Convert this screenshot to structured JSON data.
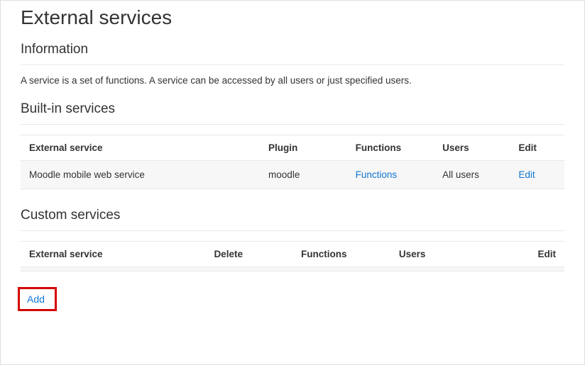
{
  "page": {
    "title": "External services"
  },
  "information": {
    "heading": "Information",
    "text": "A service is a set of functions. A service can be accessed by all users or just specified users."
  },
  "builtin": {
    "heading": "Built-in services",
    "headers": {
      "external_service": "External service",
      "plugin": "Plugin",
      "functions": "Functions",
      "users": "Users",
      "edit": "Edit"
    },
    "rows": [
      {
        "name": "Moodle mobile web service",
        "plugin": "moodle",
        "functions_link": "Functions",
        "users": "All users",
        "edit_link": "Edit"
      }
    ]
  },
  "custom": {
    "heading": "Custom services",
    "headers": {
      "external_service": "External service",
      "delete": "Delete",
      "functions": "Functions",
      "users": "Users",
      "edit": "Edit"
    }
  },
  "actions": {
    "add": "Add"
  }
}
